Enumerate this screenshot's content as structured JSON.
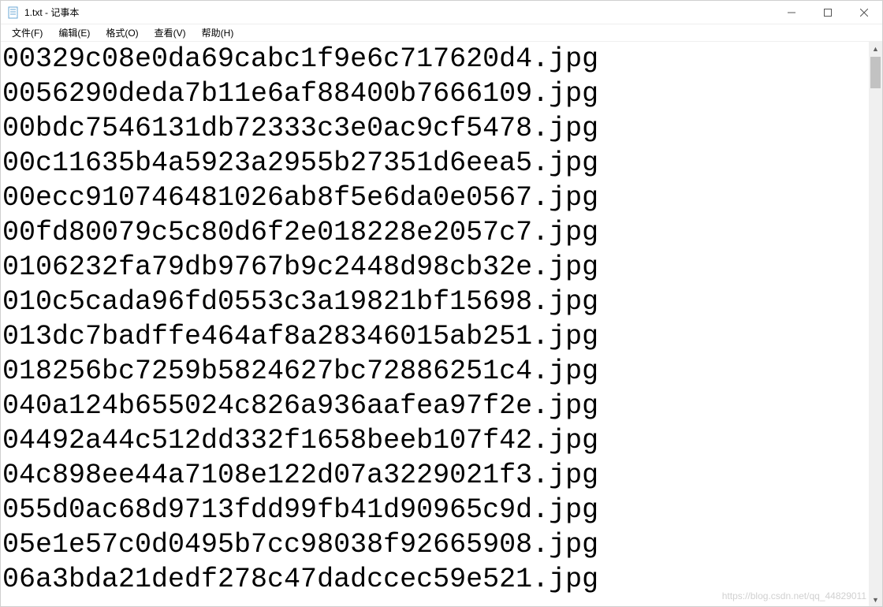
{
  "titlebar": {
    "title": "1.txt - 记事本"
  },
  "menu": {
    "file": "文件(F)",
    "edit": "编辑(E)",
    "format": "格式(O)",
    "view": "查看(V)",
    "help": "帮助(H)"
  },
  "lines": [
    "00329c08e0da69cabc1f9e6c717620d4.jpg",
    "0056290deda7b11e6af88400b7666109.jpg",
    "00bdc7546131db72333c3e0ac9cf5478.jpg",
    "00c11635b4a5923a2955b27351d6eea5.jpg",
    "00ecc910746481026ab8f5e6da0e0567.jpg",
    "00fd80079c5c80d6f2e018228e2057c7.jpg",
    "0106232fa79db9767b9c2448d98cb32e.jpg",
    "010c5cada96fd0553c3a19821bf15698.jpg",
    "013dc7badffe464af8a28346015ab251.jpg",
    "018256bc7259b5824627bc72886251c4.jpg",
    "040a124b655024c826a936aafea97f2e.jpg",
    "04492a44c512dd332f1658beeb107f42.jpg",
    "04c898ee44a7108e122d07a3229021f3.jpg",
    "055d0ac68d9713fdd99fb41d90965c9d.jpg",
    "05e1e57c0d0495b7cc98038f92665908.jpg",
    "06a3bda21dedf278c47dadccec59e521.jpg"
  ],
  "watermark": "https://blog.csdn.net/qq_44829011"
}
